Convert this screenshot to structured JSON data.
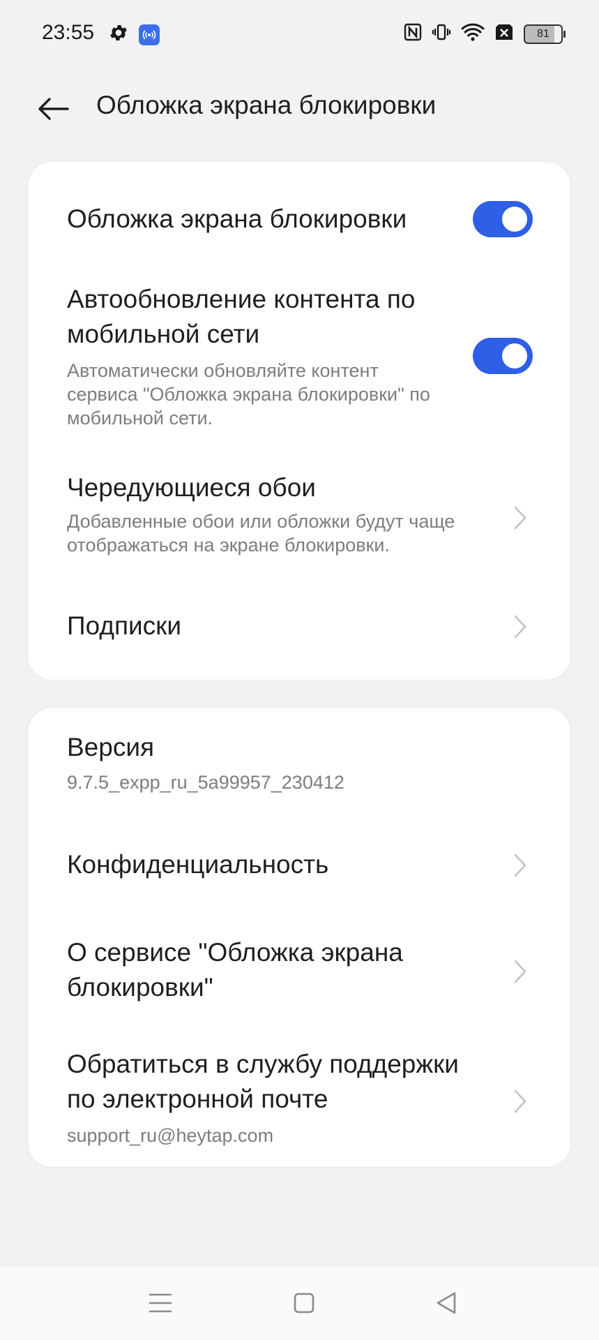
{
  "status_bar": {
    "time": "23:55",
    "battery_level": "81",
    "icons": [
      "settings-gear-icon",
      "hotspot-icon",
      "nfc-icon",
      "vibrate-icon",
      "wifi-icon",
      "no-sim-icon",
      "battery-icon"
    ]
  },
  "header": {
    "title": "Обложка экрана блокировки",
    "back_icon": "arrow-left-icon"
  },
  "card1": {
    "lockscreen_cover": {
      "title": "Обложка экрана блокировки",
      "enabled": true
    },
    "auto_update": {
      "title_line1": "Автообновление контента по",
      "title_line2": "мобильной сети",
      "sub_line1": "Автоматически обновляйте контент",
      "sub_line2": "сервиса \"Обложка экрана блокировки\" по",
      "sub_line3": "мобильной сети.",
      "enabled": true
    },
    "rotating_wallpapers": {
      "title": "Чередующиеся обои",
      "sub_line1": "Добавленные обои или обложки будут чаще",
      "sub_line2": "отображаться на экране блокировки."
    },
    "subscriptions": {
      "title": "Подписки"
    }
  },
  "card2": {
    "version": {
      "title": "Версия",
      "value": "9.7.5_expp_ru_5a99957_230412"
    },
    "privacy": {
      "title": "Конфиденциальность"
    },
    "about": {
      "title_line1": "О сервисе \"Обложка экрана",
      "title_line2": "блокировки\""
    },
    "support": {
      "title_line1": "Обратиться в службу поддержки",
      "title_line2": "по электронной почте",
      "email": "support_ru@heytap.com"
    }
  },
  "colors": {
    "accent": "#2f5fe6",
    "background": "#f2f2f4",
    "card": "#ffffff",
    "secondary_text": "#7d7d7d"
  },
  "navbar": {
    "icons": [
      "menu-icon",
      "home-square-icon",
      "back-triangle-icon"
    ]
  }
}
